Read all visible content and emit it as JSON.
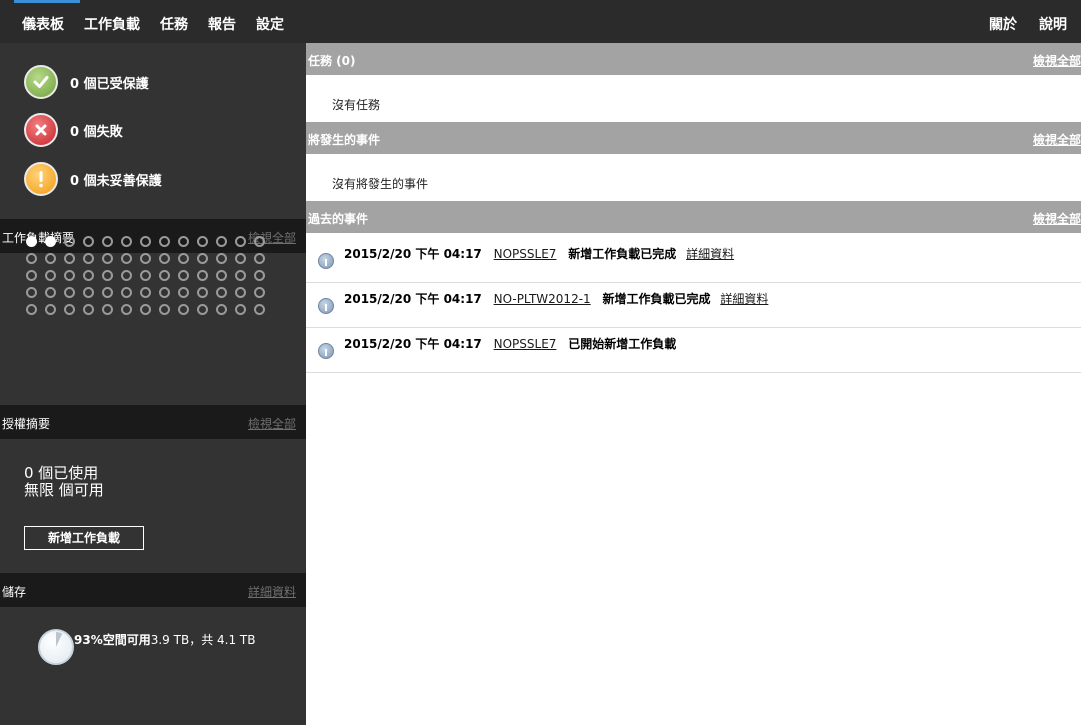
{
  "nav": {
    "left": [
      "儀表板",
      "工作負載",
      "任務",
      "報告",
      "設定"
    ],
    "right": [
      "關於",
      "說明"
    ]
  },
  "status": {
    "protected": "0 個已受保護",
    "failed": "0 個失敗",
    "unprotected": "0 個未妥善保護"
  },
  "workload_summary": {
    "title": "工作負載摘要",
    "link": "檢視全部",
    "filled_dots": 2,
    "total_dots": 65
  },
  "license_summary": {
    "title": "授權摘要",
    "link": "檢視全部",
    "used": "0 個已使用",
    "available": "無限 個可用",
    "add_button": "新增工作負載"
  },
  "storage": {
    "title": "儲存",
    "link": "詳細資料",
    "free_label": "93%空間可用",
    "sizes": "3.9 TB，共 4.1 TB",
    "free_fraction": 0.93
  },
  "tasks": {
    "title": "任務 (0)",
    "link": "檢視全部",
    "empty": "沒有任務"
  },
  "upcoming": {
    "title": "將發生的事件",
    "link": "檢視全部",
    "empty": "沒有將發生的事件"
  },
  "past": {
    "title": "過去的事件",
    "link": "檢視全部",
    "events": [
      {
        "time": "2015/2/20 下午 04:17",
        "machine": "NOPSSLE7",
        "message": "新增工作負載已完成",
        "details": "詳細資料"
      },
      {
        "time": "2015/2/20 下午 04:17",
        "machine": "NO-PLTW2012-1",
        "message": "新增工作負載已完成",
        "details": "詳細資料"
      },
      {
        "time": "2015/2/20 下午 04:17",
        "machine": "NOPSSLE7",
        "message": "已開始新增工作負載",
        "details": ""
      }
    ]
  },
  "colors": {
    "ok": "#6fa13c",
    "fail": "#c8232c",
    "warn": "#f39c12",
    "accent": "#3b8fd6"
  }
}
